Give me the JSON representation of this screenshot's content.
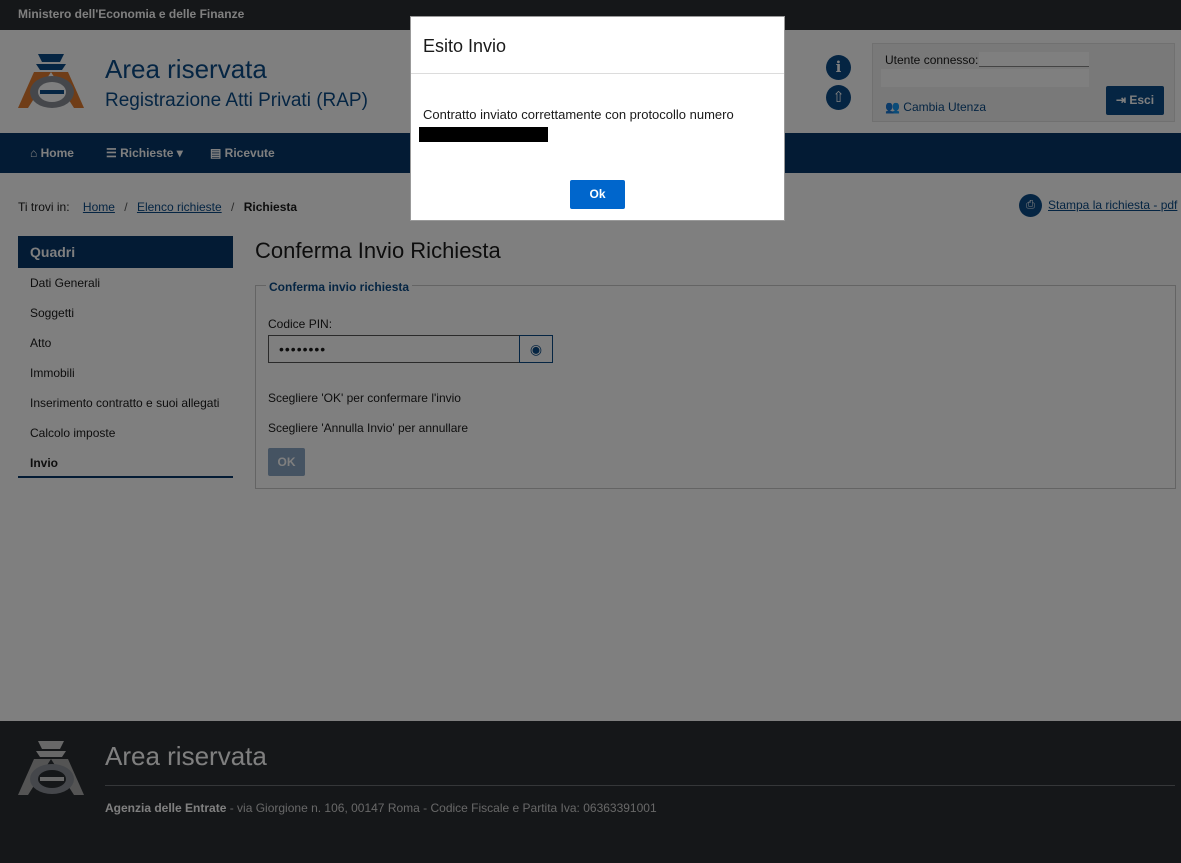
{
  "topbar": {
    "ministry": "Ministero dell'Economia e delle Finanze"
  },
  "header": {
    "title": "Area riservata",
    "subtitle": "Registrazione Atti Privati (RAP)",
    "info_icon": "info-icon",
    "upload_icon": "upload-icon"
  },
  "user": {
    "label": "Utente connesso:",
    "switch_label": "Cambia Utenza",
    "logout_label": "Esci"
  },
  "nav": {
    "home": "Home",
    "requests": "Richieste",
    "receipts": "Ricevute"
  },
  "breadcrumb": {
    "prefix": "Ti trovi in:",
    "items": [
      "Home",
      "Elenco richieste"
    ],
    "current": "Richiesta"
  },
  "print_link": "Stampa la richiesta - pdf",
  "sidebar": {
    "title": "Quadri",
    "items": [
      {
        "label": "Dati Generali"
      },
      {
        "label": "Soggetti"
      },
      {
        "label": "Atto"
      },
      {
        "label": "Immobili"
      },
      {
        "label": "Inserimento contratto e suoi allegati"
      },
      {
        "label": "Calcolo imposte"
      },
      {
        "label": "Invio"
      }
    ],
    "active": "Invio"
  },
  "main": {
    "title": "Conferma Invio Richiesta",
    "legend": "Conferma invio richiesta",
    "pin_label": "Codice PIN:",
    "pin_value": "••••••••",
    "hint_ok": "Scegliere 'OK' per confermare l'invio",
    "hint_cancel": "Scegliere 'Annulla Invio' per annullare",
    "ok_label": "OK"
  },
  "footer": {
    "title": "Area riservata",
    "org": "Agenzia delle Entrate",
    "address": " - via Giorgione n. 106, 00147 Roma - Codice Fiscale e Partita Iva: 06363391001"
  },
  "modal": {
    "title": "Esito Invio",
    "message": "Contratto inviato correttamente con protocollo numero",
    "ok_label": "Ok"
  },
  "colors": {
    "brand_blue": "#0b4a86",
    "nav_blue": "#063768",
    "dark_bar": "#2b2f33",
    "primary_button": "#0066cc"
  }
}
